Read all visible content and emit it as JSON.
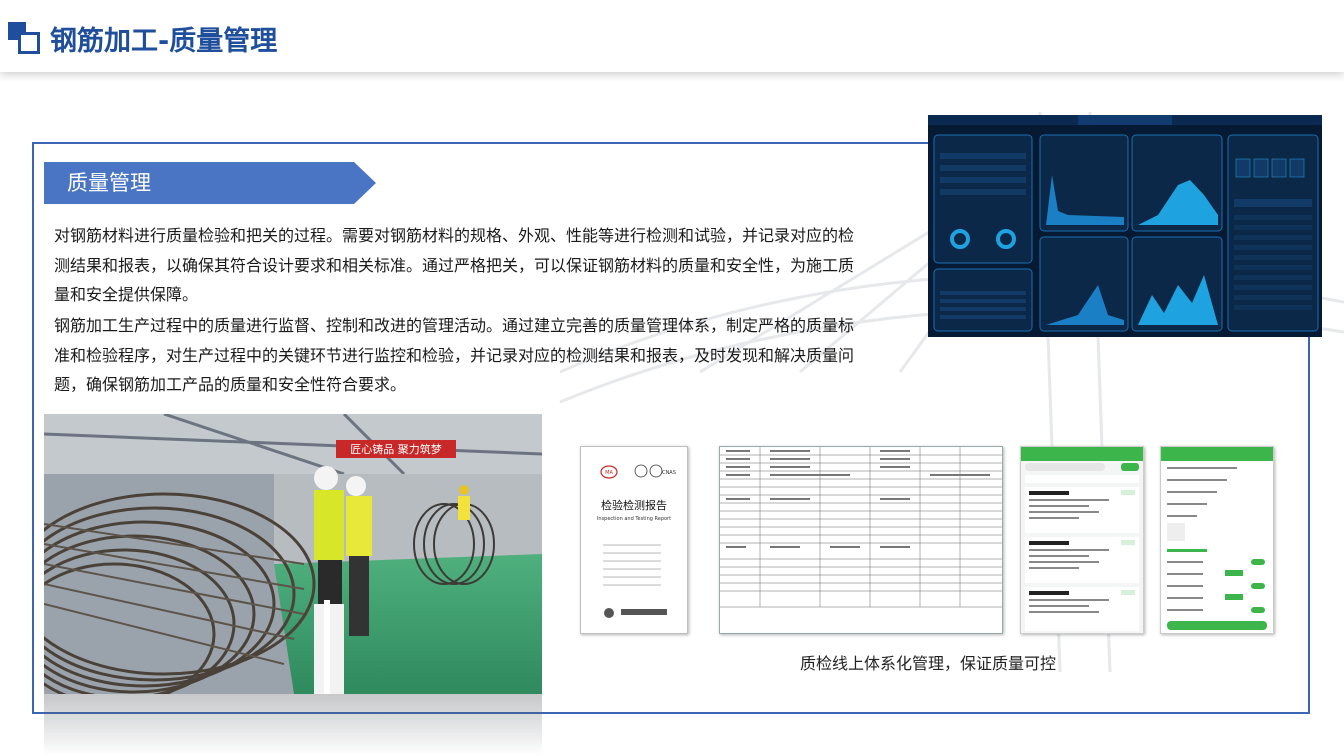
{
  "header": {
    "title": "钢筋加工-质量管理"
  },
  "section": {
    "tag": "质量管理",
    "paragraphs": [
      "对钢筋材料进行质量检验和把关的过程。需要对钢筋材料的规格、外观、性能等进行检测和试验，并记录对应的检测结果和报表，以确保其符合设计要求和相关标准。通过严格把关，可以保证钢筋材料的质量和安全性，为施工质量和安全提供保障。",
      "钢筋加工生产过程中的质量进行监督、控制和改进的管理活动。通过建立完善的质量管理体系，制定严格的质量标准和检验程序，对生产过程中的关键环节进行监控和检验，并记录对应的检测结果和报表，及时发现和解决质量问题，确保钢筋加工产品的质量和安全性符合要求。"
    ]
  },
  "photo": {
    "banner": "匠心铸品   聚力筑梦"
  },
  "certificate": {
    "title_cn": "检验检测报告",
    "title_en": "Inspection and Testing Report",
    "marks": [
      "MA",
      "CNAS"
    ]
  },
  "caption": "质检线上体系化管理，保证质量可控",
  "colors": {
    "brand_blue": "#1f4e9c",
    "frame_blue": "#3a66b5",
    "tag_blue": "#4a74c4",
    "dashboard_bg": "#071a33",
    "dashboard_accent": "#1fa3e0",
    "app_green": "#3cb54a"
  }
}
